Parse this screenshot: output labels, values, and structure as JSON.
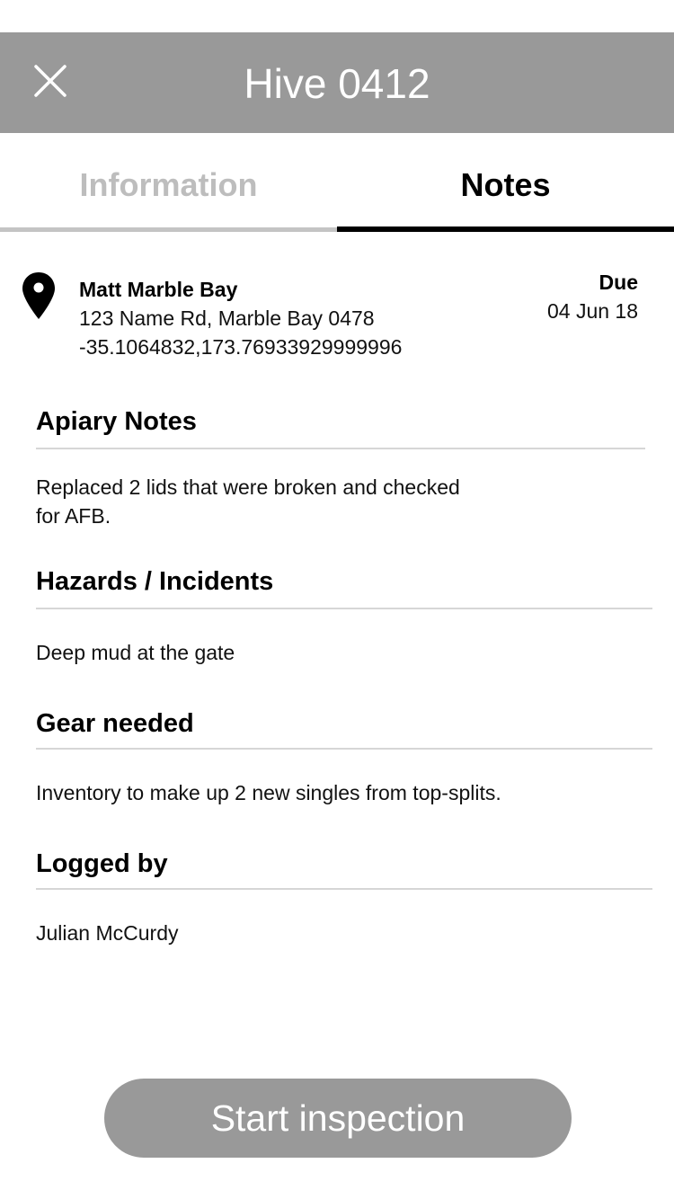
{
  "header": {
    "title": "Hive 0412",
    "close_icon": "close-icon",
    "background_color": "#999999"
  },
  "tabs": [
    {
      "label": "Information",
      "active": false
    },
    {
      "label": "Notes",
      "active": true
    }
  ],
  "location": {
    "icon": "map-pin-icon",
    "name": "Matt Marble Bay",
    "address": "123 Name Rd, Marble Bay 0478",
    "coordinates": "-35.1064832,173.76933929999996",
    "due_label": "Due",
    "due_date": "04 Jun 18"
  },
  "sections": {
    "apiary_notes": {
      "heading": "Apiary Notes",
      "body_line1": "Replaced 2 lids that were broken and checked",
      "body_line2": "for AFB."
    },
    "hazards": {
      "heading": "Hazards / Incidents",
      "body": "Deep mud at the gate"
    },
    "gear": {
      "heading": "Gear needed",
      "body": "Inventory to make up 2 new singles from top-splits."
    },
    "logged_by": {
      "heading": "Logged by",
      "body": "Julian McCurdy"
    }
  },
  "actions": {
    "start_inspection_label": "Start inspection",
    "button_color": "#999999"
  }
}
